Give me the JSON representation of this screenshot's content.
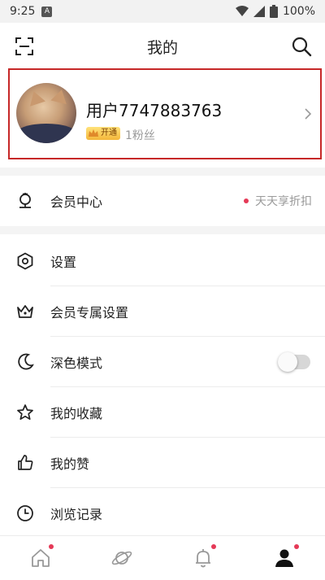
{
  "status_bar": {
    "time": "9:25",
    "notification_letter": "A",
    "battery": "100%"
  },
  "header": {
    "title": "我的"
  },
  "profile": {
    "username": "用户7747883763",
    "vip_badge": "开通",
    "fans": "1粉丝"
  },
  "menu": {
    "member_center": {
      "label": "会员中心",
      "hint": "天天享折扣"
    },
    "items": [
      {
        "label": "设置"
      },
      {
        "label": "会员专属设置"
      },
      {
        "label": "深色模式",
        "toggle_on": false
      },
      {
        "label": "我的收藏"
      },
      {
        "label": "我的赞"
      },
      {
        "label": "浏览记录"
      }
    ]
  },
  "tabbar": {
    "tabs": [
      {
        "icon": "home-icon",
        "has_dot": true
      },
      {
        "icon": "planet-icon",
        "has_dot": false
      },
      {
        "icon": "bell-icon",
        "has_dot": true
      },
      {
        "icon": "profile-icon",
        "has_dot": true,
        "active": true
      }
    ]
  },
  "colors": {
    "accent_red": "#e53957",
    "highlight_border": "#c62828"
  }
}
